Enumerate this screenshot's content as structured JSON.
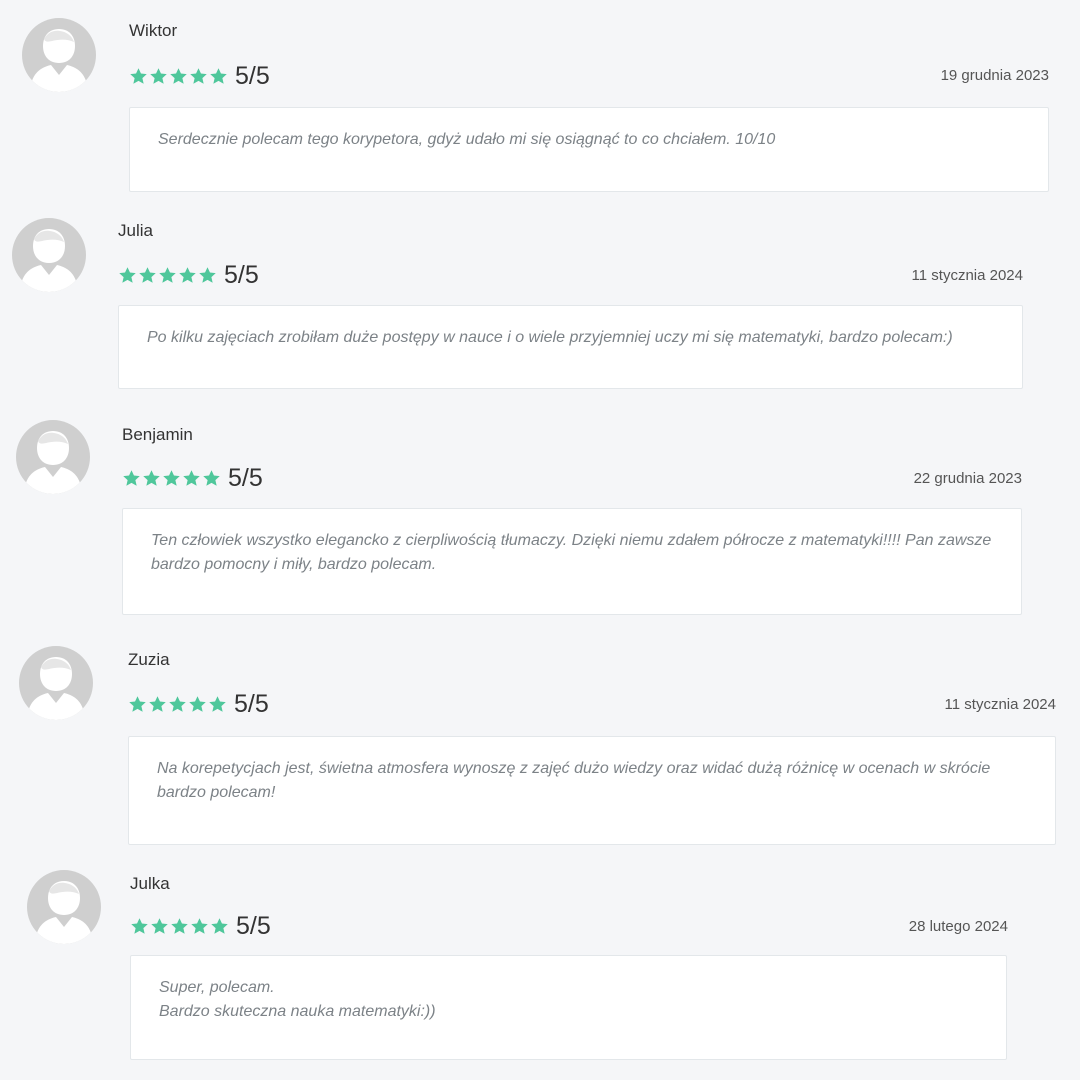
{
  "accent_color": "#4fc79b",
  "avatar_icon": "user-silhouette-icon",
  "star_icon": "star-icon",
  "reviews": [
    {
      "name": "Wiktor",
      "stars": 5,
      "score": "5/5",
      "date": "19 grudnia 2023",
      "text": "Serdecznie polecam tego korypetora, gdyż udało mi się osiągnąć to co chciałem. 10/10"
    },
    {
      "name": "Julia",
      "stars": 5,
      "score": "5/5",
      "date": "11 stycznia 2024",
      "text": "Po kilku zajęciach zrobiłam duże postępy w nauce i o wiele przyjemniej uczy mi się matematyki, bardzo polecam:)"
    },
    {
      "name": "Benjamin",
      "stars": 5,
      "score": "5/5",
      "date": "22 grudnia 2023",
      "text": "Ten człowiek wszystko elegancko z cierpliwością tłumaczy. Dzięki niemu zdałem półrocze z matematyki!!!! Pan zawsze bardzo pomocny i miły, bardzo polecam."
    },
    {
      "name": "Zuzia",
      "stars": 5,
      "score": "5/5",
      "date": "11 stycznia 2024",
      "text": "Na korepetycjach jest, świetna atmosfera wynoszę z zajęć dużo wiedzy oraz widać dużą różnicę w ocenach w skrócie bardzo polecam!"
    },
    {
      "name": "Julka",
      "stars": 5,
      "score": "5/5",
      "date": "28 lutego 2024",
      "text": "Super, polecam.\nBardzo skuteczna nauka matematyki:))"
    }
  ]
}
